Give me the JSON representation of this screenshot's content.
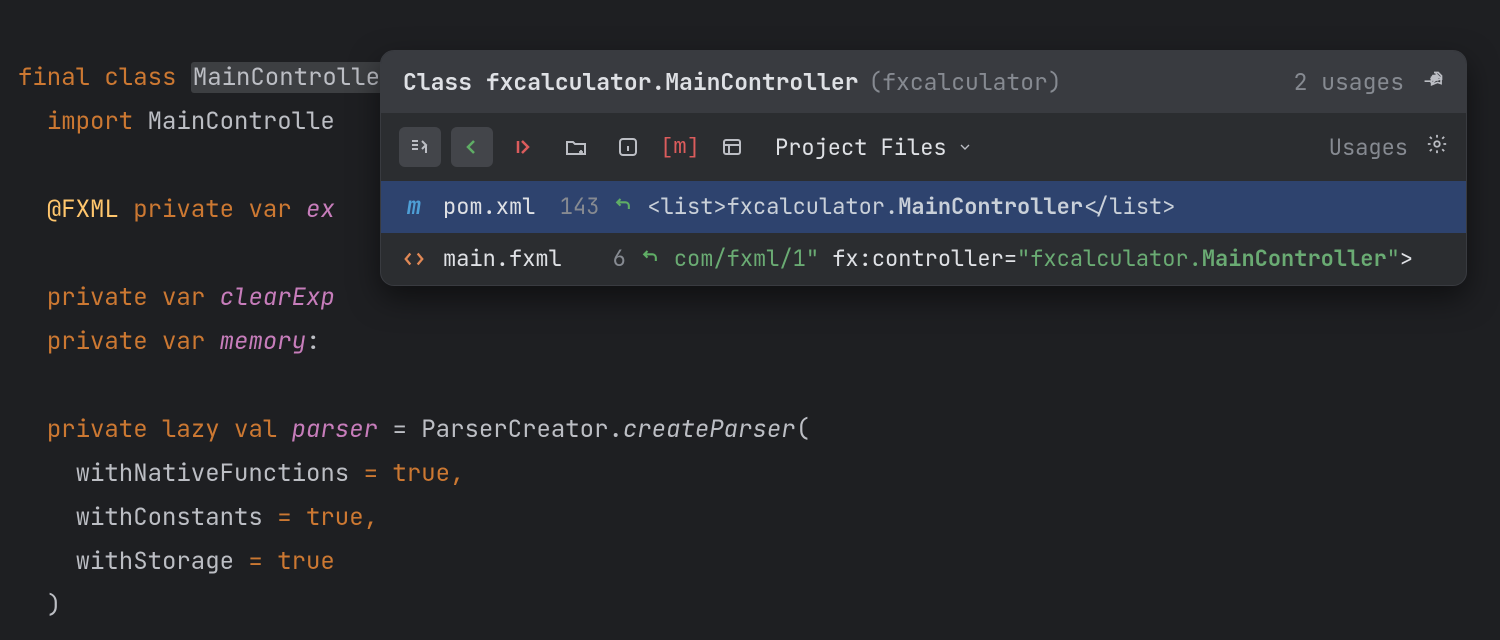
{
  "code": {
    "line1": {
      "kw1": "final",
      "kw2": "class",
      "className": "MainController",
      "colon": ":"
    },
    "line2": {
      "kw": "import",
      "name": "MainControlle"
    },
    "line3": {
      "ann": "@FXML",
      "kw1": "private",
      "kw2": "var",
      "name": "ex"
    },
    "line4": {
      "kw1": "private",
      "kw2": "var",
      "name": "clearExp"
    },
    "line5": {
      "kw1": "private",
      "kw2": "var",
      "name": "memory",
      "colon": ":"
    },
    "line6": {
      "kw1": "private",
      "kw2": "lazy",
      "kw3": "val",
      "name": "parser",
      "eq": " = ",
      "cls": "ParserCreator",
      "dot": ".",
      "method": "createParser",
      "open": "("
    },
    "line7": {
      "param": "withNativeFunctions",
      "rest": " = true,"
    },
    "line8": {
      "param": "withConstants",
      "rest": " = true,"
    },
    "line9": {
      "param": "withStorage",
      "rest": " = true"
    },
    "line10": {
      "close": ")"
    }
  },
  "popup": {
    "title_prefix": "Class ",
    "title_main": "fxcalculator.MainController",
    "subtitle": "(fxcalculator)",
    "usage_count": "2 usages",
    "scope_label": "Project Files",
    "usages_label": "Usages",
    "results": [
      {
        "icon": "m",
        "filename": "pom.xml",
        "line": "143",
        "snippet": {
          "parts": [
            {
              "text": "<list>",
              "cls": "tag sel"
            },
            {
              "text": "fxcalculator.",
              "cls": "tag sel"
            },
            {
              "text": "MainController",
              "cls": "tag sel bold"
            },
            {
              "text": "</list>",
              "cls": "tag sel"
            }
          ]
        },
        "selected": true
      },
      {
        "icon": "xml",
        "filename": "main.fxml",
        "line": "6",
        "snippet": {
          "parts": [
            {
              "text": "com/fxml/1\"",
              "cls": "green"
            },
            {
              "text": " fx:controller=",
              "cls": "attr"
            },
            {
              "text": "\"fxcalculator.",
              "cls": "green"
            },
            {
              "text": "MainController",
              "cls": "green bold"
            },
            {
              "text": "\"",
              "cls": "green"
            },
            {
              "text": ">",
              "cls": "attr"
            }
          ]
        },
        "selected": false
      }
    ]
  }
}
